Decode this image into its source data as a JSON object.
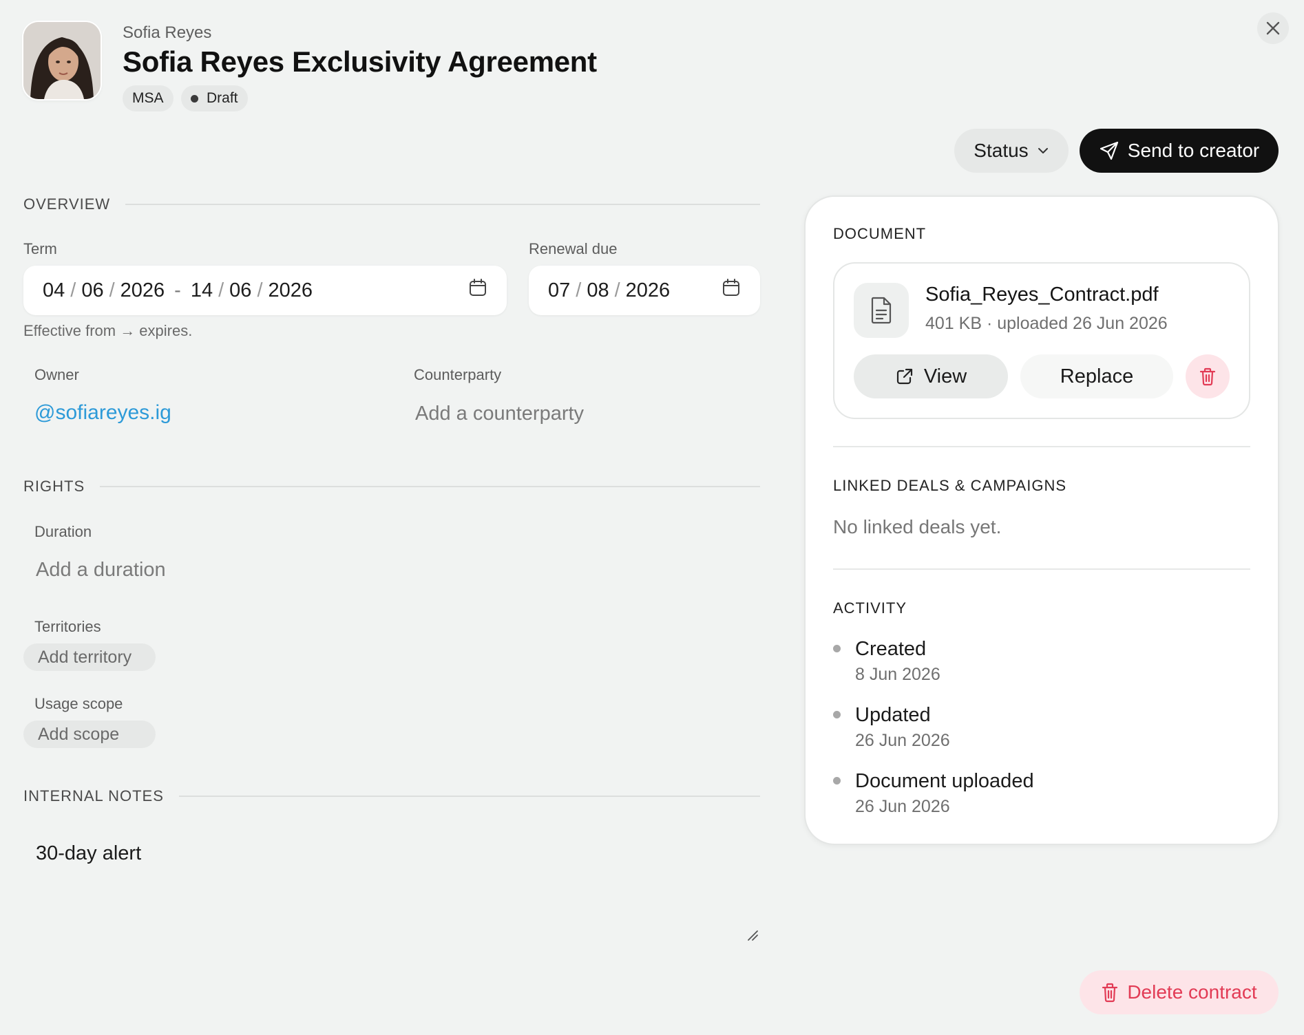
{
  "header": {
    "creator_name": "Sofia Reyes",
    "title": "Sofia Reyes Exclusivity Agreement",
    "tags": {
      "type": "MSA",
      "status": "Draft"
    },
    "avatar_icon": "user-photo-avatar",
    "close_icon": "close-icon"
  },
  "actions": {
    "status_label": "Status",
    "send_label": "Send to creator",
    "delete_label": "Delete contract"
  },
  "overview": {
    "heading": "OVERVIEW",
    "term": {
      "label": "Term",
      "start": {
        "dd": "04",
        "mm": "06",
        "yyyy": "2026"
      },
      "end": {
        "dd": "14",
        "mm": "06",
        "yyyy": "2026"
      },
      "hint": "Effective from → expires."
    },
    "renewal": {
      "label": "Renewal due",
      "date": {
        "dd": "07",
        "mm": "08",
        "yyyy": "2026"
      }
    },
    "owner": {
      "label": "Owner",
      "value": "@sofiareyes.ig"
    },
    "counterparty": {
      "label": "Counterparty",
      "placeholder": "Add a counterparty"
    }
  },
  "rights": {
    "heading": "RIGHTS",
    "duration": {
      "label": "Duration",
      "placeholder": "Add a duration"
    },
    "territories": {
      "label": "Territories",
      "add_label": "Add territory"
    },
    "usage_scope": {
      "label": "Usage scope",
      "add_label": "Add scope"
    }
  },
  "notes": {
    "heading": "INTERNAL NOTES",
    "value": "30-day alert"
  },
  "document": {
    "heading": "DOCUMENT",
    "file_name": "Sofia_Reyes_Contract.pdf",
    "meta": "401 KB · uploaded 26 Jun 2026",
    "view_label": "View",
    "replace_label": "Replace"
  },
  "linked": {
    "heading": "LINKED DEALS & CAMPAIGNS",
    "empty": "No linked deals yet."
  },
  "activity": {
    "heading": "ACTIVITY",
    "items": [
      {
        "title": "Created",
        "date": "8 Jun 2026"
      },
      {
        "title": "Updated",
        "date": "26 Jun 2026"
      },
      {
        "title": "Document uploaded",
        "date": "26 Jun 2026"
      }
    ]
  },
  "colors": {
    "background": "#f1f3f2",
    "accent_link": "#2d9ad8",
    "danger": "#e23b55",
    "danger_bg": "#fde4e8",
    "primary_button": "#111111"
  }
}
